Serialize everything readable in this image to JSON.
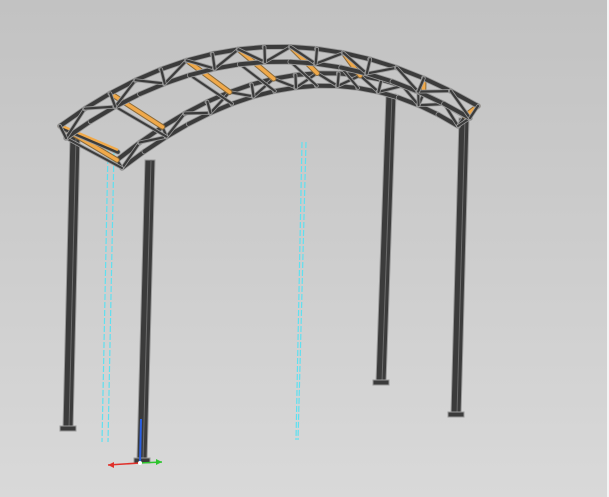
{
  "viewport": {
    "title": "",
    "background": "#cbcbcb"
  },
  "model": {
    "object": "arched-canopy-truss",
    "frame_color": "#3b3b3b",
    "edge_color": "#9a9a9a",
    "purlin_color": "#f0a94a",
    "sketch_line_color": "#5fe0f0",
    "panel_count": 8,
    "purlin_count": 6,
    "column_count": 4
  },
  "triad": {
    "x_color": "#e0302a",
    "y_color": "#2ec42e",
    "z_color": "#2a5fe0"
  }
}
